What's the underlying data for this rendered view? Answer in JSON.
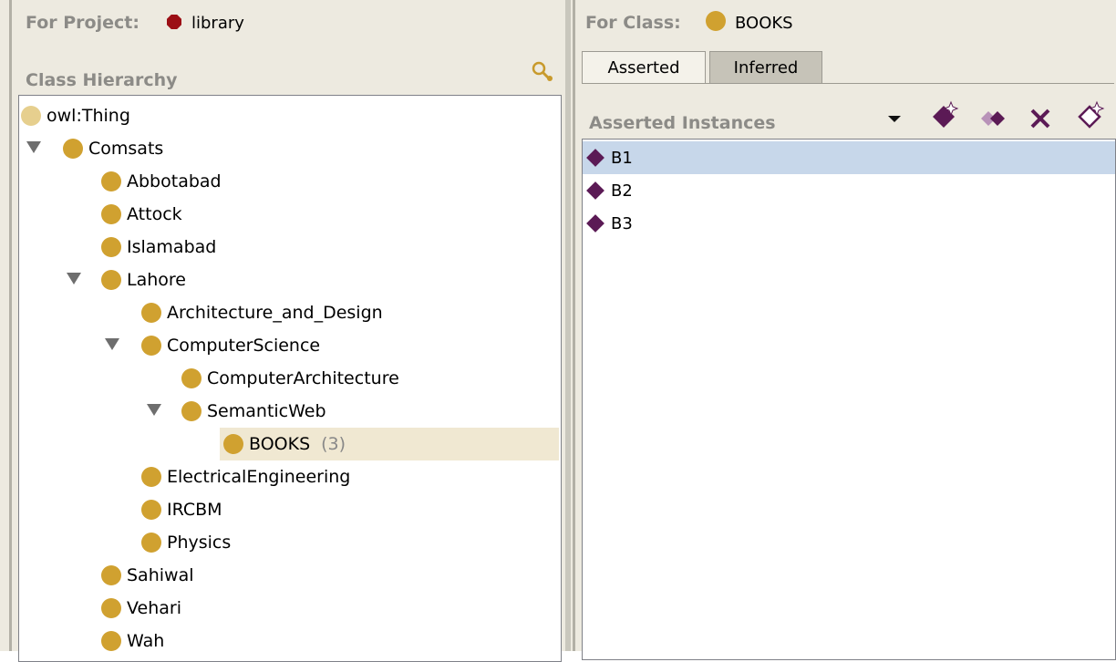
{
  "left": {
    "project_label": "For Project:",
    "project_name": "library",
    "section_title": "Class Hierarchy",
    "tree": [
      {
        "label": "owl:Thing"
      },
      {
        "label": "Comsats"
      },
      {
        "label": "Abbotabad"
      },
      {
        "label": "Attock"
      },
      {
        "label": "Islamabad"
      },
      {
        "label": "Lahore"
      },
      {
        "label": "Architecture_and_Design"
      },
      {
        "label": "ComputerScience"
      },
      {
        "label": "ComputerArchitecture"
      },
      {
        "label": "SemanticWeb"
      },
      {
        "label": "BOOKS",
        "count": "(3)"
      },
      {
        "label": "ElectricalEngineering"
      },
      {
        "label": "IRCBM"
      },
      {
        "label": "Physics"
      },
      {
        "label": "Sahiwal"
      },
      {
        "label": "Vehari"
      },
      {
        "label": "Wah"
      }
    ]
  },
  "right": {
    "class_label": "For Class:",
    "class_name": "BOOKS",
    "tabs": [
      {
        "label": "Asserted"
      },
      {
        "label": "Inferred"
      }
    ],
    "section_title": "Asserted Instances",
    "instances": [
      {
        "label": "B1"
      },
      {
        "label": "B2"
      },
      {
        "label": "B3"
      }
    ]
  },
  "colors": {
    "class_dot": "#d0a130",
    "project_hex": "#9c0f15",
    "instance_diamond": "#5b1a55",
    "selection_instance": "#c7d7ea",
    "selection_class": "#f0e8d2"
  },
  "icons": [
    "search-class-icon",
    "dropdown-arrow-icon",
    "create-instance-icon",
    "copy-instance-icon",
    "delete-instance-icon",
    "edit-instance-icon"
  ]
}
